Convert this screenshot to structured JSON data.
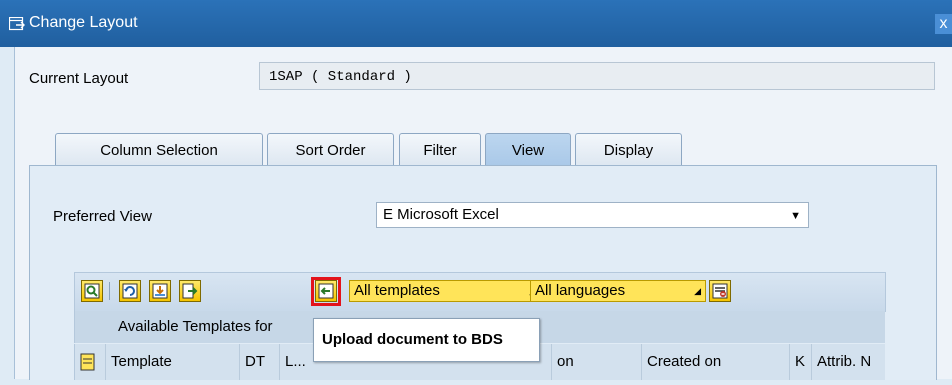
{
  "window": {
    "title": "Change Layout",
    "close_glyph": "x"
  },
  "current_layout": {
    "label": "Current Layout",
    "value": "1SAP ( Standard )"
  },
  "tabs": [
    {
      "label": "Column Selection"
    },
    {
      "label": "Sort Order"
    },
    {
      "label": "Filter"
    },
    {
      "label": "View"
    },
    {
      "label": "Display"
    }
  ],
  "active_tab": "View",
  "preferred_view": {
    "label": "Preferred View",
    "value": "E Microsoft Excel"
  },
  "toolbar": {
    "icons": [
      "details-icon",
      "refresh-icon",
      "download-icon",
      "export-icon",
      "upload-document-icon",
      "settings-icon"
    ],
    "templates_dropdown": "All templates",
    "languages_dropdown": "All languages"
  },
  "available_templates_label": "Available Templates for",
  "table_headers": [
    "Template",
    "DT",
    "L...",
    "on",
    "Created on",
    "K",
    "Attrib. N"
  ],
  "tooltip": "Upload document to BDS",
  "colors": {
    "titlebar": "#2366a8",
    "highlight": "#e3131b",
    "toolbar_button": "#f5c400"
  }
}
